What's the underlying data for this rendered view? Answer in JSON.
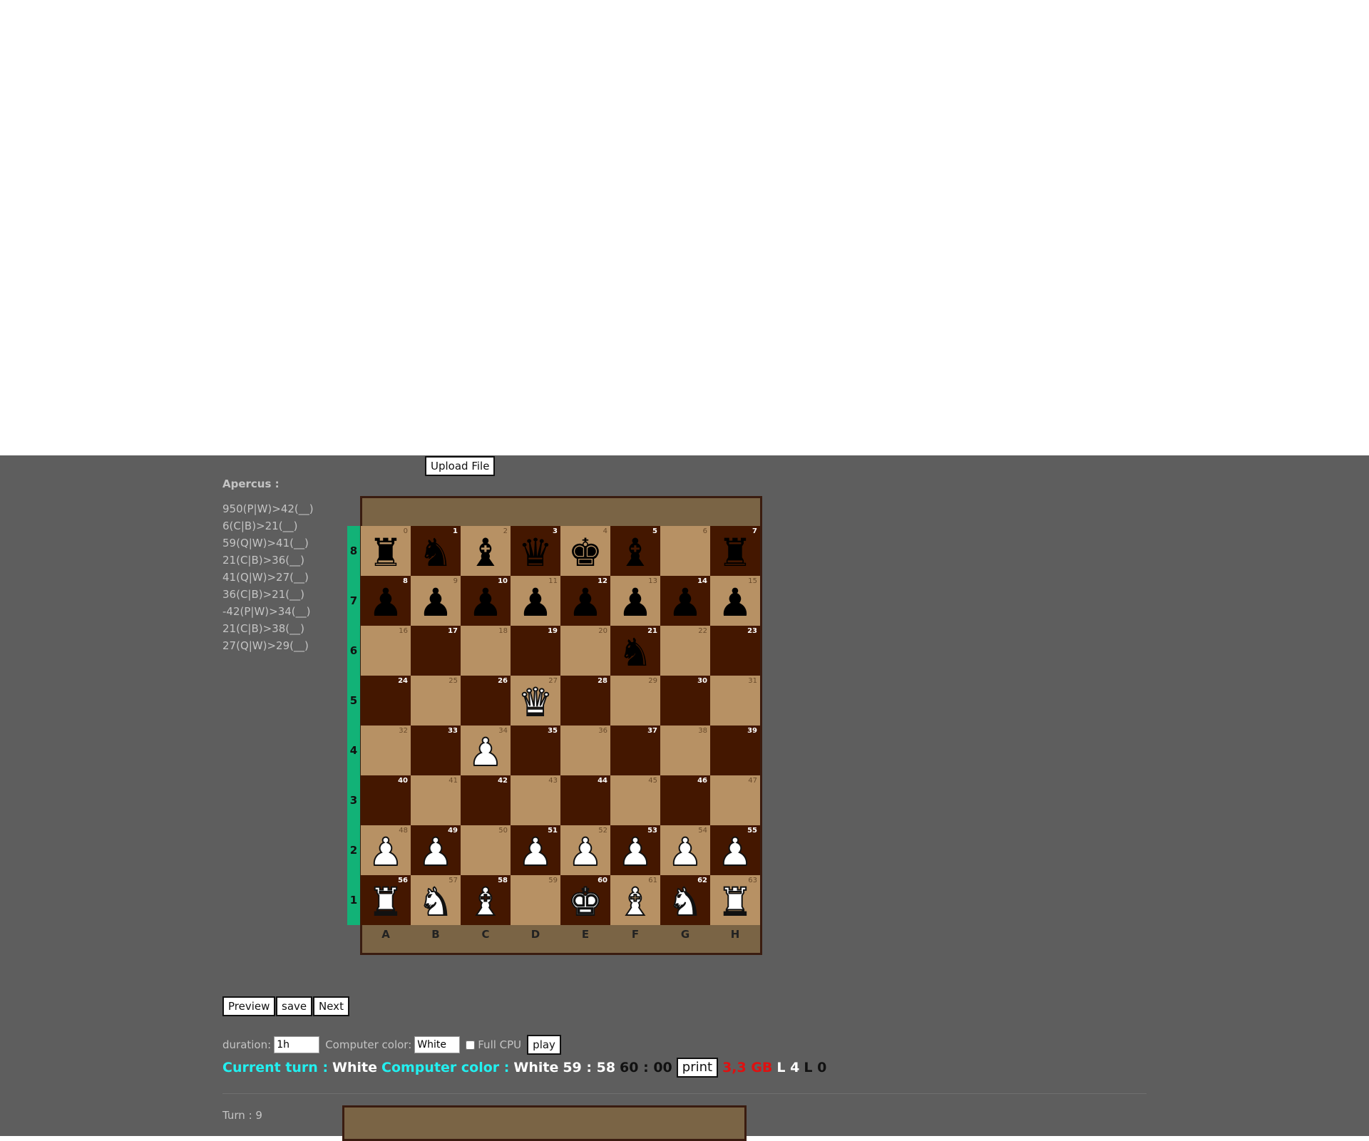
{
  "upload_button": "Upload File",
  "sidebar": {
    "title": "Apercus :",
    "items": [
      "950(P|W)>42(__)",
      "6(C|B)>21(__)",
      "59(Q|W)>41(__)",
      "21(C|B)>36(__)",
      "41(Q|W)>27(__)",
      "36(C|B)>21(__)",
      "-42(P|W)>34(__)",
      "21(C|B)>38(__)",
      "27(Q|W)>29(__)"
    ]
  },
  "board": {
    "files": [
      "A",
      "B",
      "C",
      "D",
      "E",
      "F",
      "G",
      "H"
    ],
    "ranks": [
      "8",
      "7",
      "6",
      "5",
      "4",
      "3",
      "2",
      "1"
    ],
    "pieces": {
      "0": "br",
      "1": "bn",
      "2": "bb",
      "3": "bq",
      "4": "bk",
      "5": "bb",
      "7": "br",
      "8": "bp",
      "9": "bp",
      "10": "bp",
      "11": "bp",
      "12": "bp",
      "13": "bp",
      "14": "bp",
      "15": "bp",
      "21": "bn",
      "27": "wq",
      "34": "wp",
      "48": "wp",
      "49": "wp",
      "51": "wp",
      "52": "wp",
      "53": "wp",
      "54": "wp",
      "55": "wp",
      "56": "wr",
      "57": "wn",
      "58": "wb",
      "60": "wk",
      "61": "wb",
      "62": "wn",
      "63": "wr"
    },
    "colors": {
      "light": "#b79164",
      "dark": "#441700",
      "rank_bar": "#12b277"
    }
  },
  "controls": {
    "preview": "Preview",
    "save": "save",
    "next": "Next",
    "duration_label": "duration:",
    "duration_value": "1h",
    "computer_color_label": "Computer color:",
    "computer_color_value": "White",
    "full_cpu_label": "Full CPU",
    "play": "play"
  },
  "status": {
    "current_turn_label": "Current turn :",
    "current_turn_value": "White",
    "computer_color_label": "Computer color :",
    "computer_color_value": "White",
    "time_white": "59 : 58",
    "time_black": "60 : 00",
    "print_button": "print",
    "memory": "3,3 GB",
    "level_white": "L 4",
    "level_black": "L 0"
  },
  "turn": "Turn : 9"
}
